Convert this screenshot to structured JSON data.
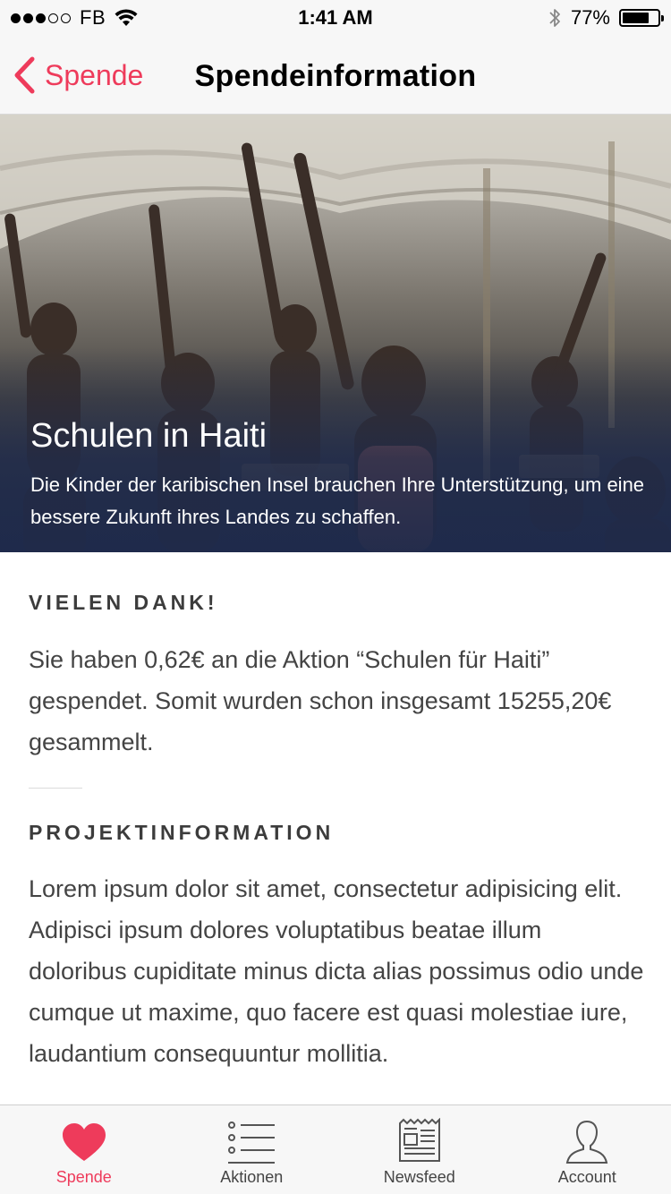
{
  "status_bar": {
    "carrier": "FB",
    "time": "1:41 AM",
    "battery_percent": "77%",
    "battery_level": 0.77,
    "signal_bars": 3
  },
  "nav": {
    "back_label": "Spende",
    "title": "Spendeinformation"
  },
  "hero": {
    "title": "Schulen in Haiti",
    "subtitle": "Die Kinder der karibischen Insel brauchen Ihre Unterstützung, um eine bessere Zukunft ihres Landes zu schaffen."
  },
  "thanks": {
    "heading": "VIELEN DANK!",
    "body": "Sie haben 0,62€ an die Aktion “Schulen für Haiti” gespendet. Somit wurden schon insgesamt 15255,20€ gesammelt."
  },
  "project": {
    "heading": "PROJEKTINFORMATION",
    "body": "Lorem ipsum dolor sit amet, consectetur adipisicing elit. Adipisci ipsum dolores voluptatibus beatae illum doloribus cupiditate minus dicta alias possimus odio unde cumque ut maxime, quo facere est quasi molestiae iure, laudantium consequuntur mollitia."
  },
  "tabs": [
    {
      "label": "Spende",
      "icon": "heart-icon",
      "active": true
    },
    {
      "label": "Aktionen",
      "icon": "list-icon",
      "active": false
    },
    {
      "label": "Newsfeed",
      "icon": "newspaper-icon",
      "active": false
    },
    {
      "label": "Account",
      "icon": "person-icon",
      "active": false
    }
  ],
  "colors": {
    "accent": "#ee3b5b",
    "hero_overlay": "#1e2a4b",
    "bar_background": "#f7f7f7"
  }
}
